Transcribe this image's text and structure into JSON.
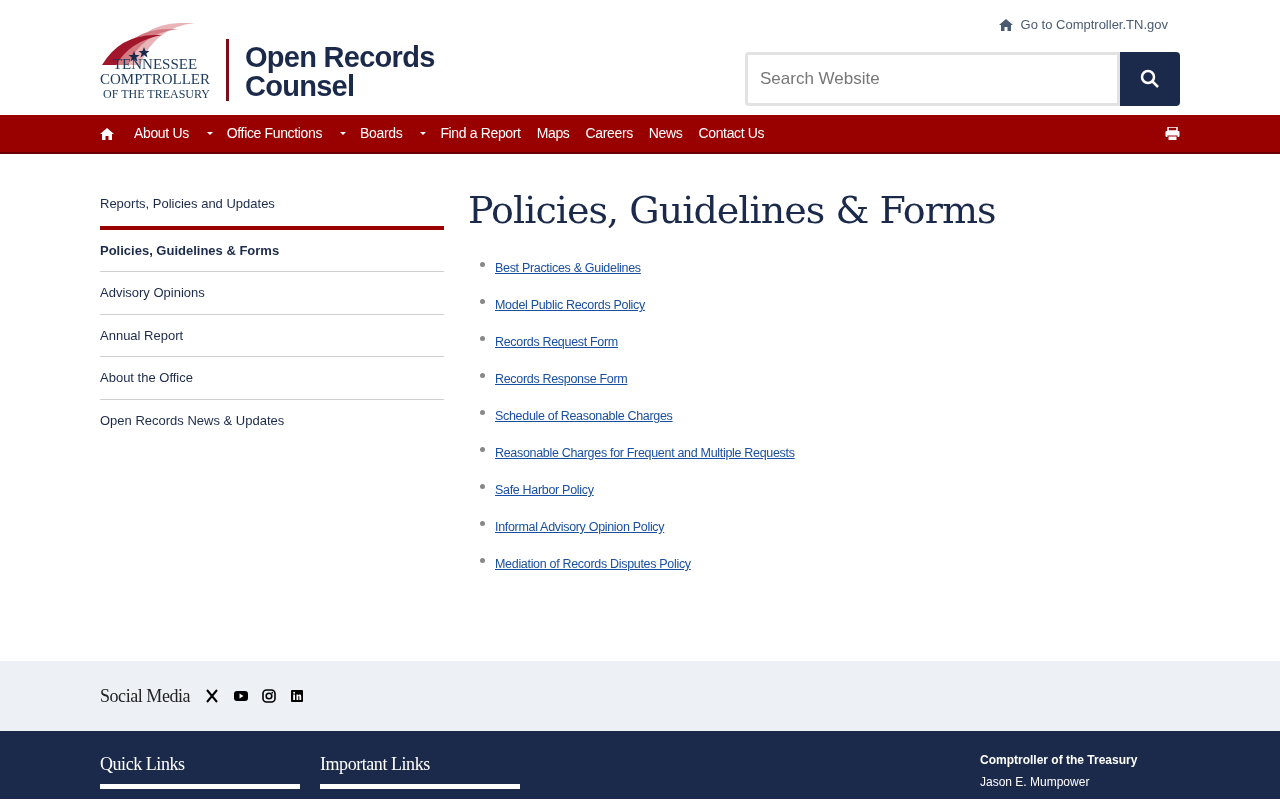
{
  "header": {
    "logo_lines": [
      "TENNESSEE",
      "COMPTROLLER",
      "OF THE TREASURY"
    ],
    "site_title_lines": [
      "Open Records",
      "Counsel"
    ],
    "top_link": "Go to Comptroller.TN.gov",
    "search": {
      "placeholder": "Search Website"
    }
  },
  "nav": [
    {
      "label": "About Us",
      "has_dropdown": true
    },
    {
      "label": "Office Functions",
      "has_dropdown": true
    },
    {
      "label": "Boards",
      "has_dropdown": true
    },
    {
      "label": "Find a Report",
      "has_dropdown": false
    },
    {
      "label": "Maps",
      "has_dropdown": false
    },
    {
      "label": "Careers",
      "has_dropdown": false
    },
    {
      "label": "News",
      "has_dropdown": false
    },
    {
      "label": "Contact Us",
      "has_dropdown": false
    }
  ],
  "sidebar": {
    "parent": "Reports, Policies and Updates",
    "items": [
      {
        "label": "Policies, Guidelines & Forms",
        "selected": true
      },
      {
        "label": "Advisory Opinions",
        "selected": false
      },
      {
        "label": "Annual Report",
        "selected": false
      },
      {
        "label": "About the Office",
        "selected": false
      },
      {
        "label": "Open Records News & Updates",
        "selected": false
      }
    ]
  },
  "main": {
    "title": "Policies, Guidelines & Forms",
    "links": [
      "Best Practices & Guidelines",
      "Model Public Records Policy",
      "Records Request Form",
      "Records Response Form",
      "Schedule of Reasonable Charges",
      "Reasonable Charges for Frequent and Multiple Requests",
      "Safe Harbor Policy",
      "Informal Advisory Opinion Policy",
      "Mediation of Records Disputes Policy"
    ]
  },
  "social": {
    "label": "Social Media",
    "icons": [
      {
        "kind": "x"
      },
      {
        "kind": "youtube"
      },
      {
        "kind": "instagram"
      },
      {
        "kind": "linkedin"
      }
    ]
  },
  "footer": {
    "headings": [
      "Quick Links",
      "Important Links"
    ],
    "office": "Comptroller of the Treasury",
    "person": "Jason E. Mumpower"
  }
}
